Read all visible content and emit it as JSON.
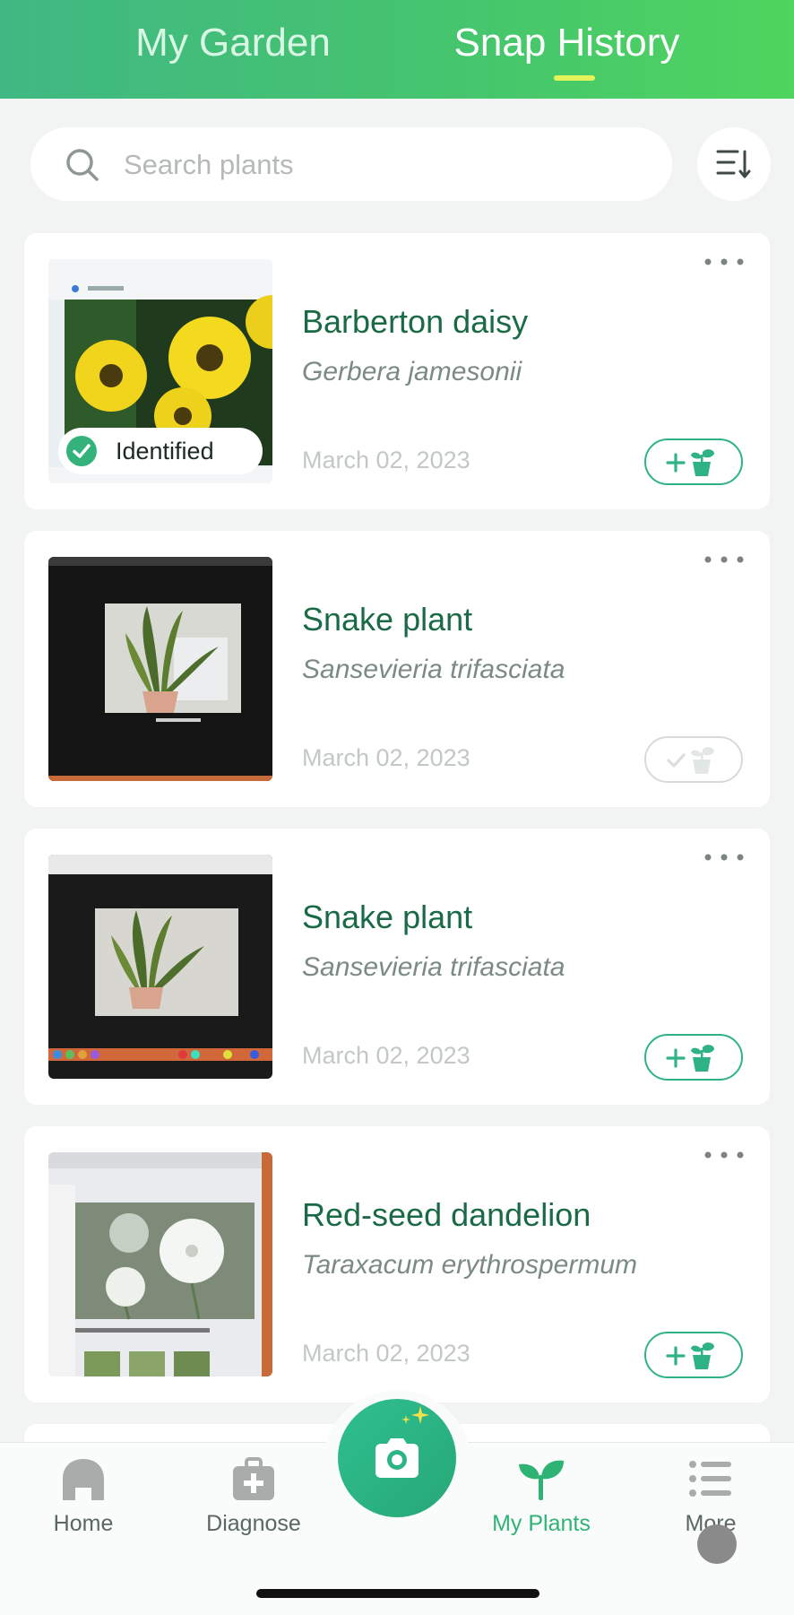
{
  "tabs": {
    "my_garden": "My Garden",
    "snap_history": "Snap History"
  },
  "search": {
    "placeholder": "Search plants"
  },
  "cards": [
    {
      "name": "Barberton daisy",
      "scientific": "Gerbera jamesonii",
      "date": "March 02, 2023",
      "badge": "Identified"
    },
    {
      "name": "Snake plant",
      "scientific": "Sansevieria trifasciata",
      "date": "March 02, 2023"
    },
    {
      "name": "Snake plant",
      "scientific": "Sansevieria trifasciata",
      "date": "March 02, 2023"
    },
    {
      "name": "Red-seed dandelion",
      "scientific": "Taraxacum erythrospermum",
      "date": "March 02, 2023"
    }
  ],
  "nav": {
    "home": "Home",
    "diagnose": "Diagnose",
    "my_plants": "My Plants",
    "more": "More"
  },
  "colors": {
    "accent": "#2fb385",
    "active_nav": "#2fb375",
    "title_green": "#196a45"
  }
}
